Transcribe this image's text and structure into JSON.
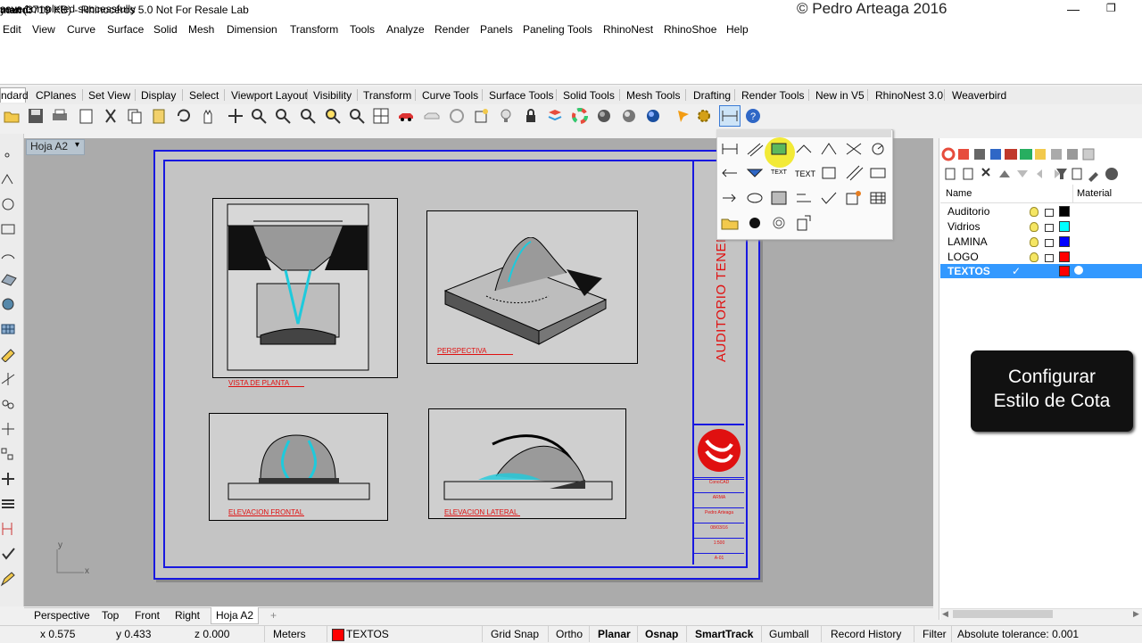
{
  "window": {
    "title": "yout (3719 KB) - Rhinoceros 5.0 Not For Resale Lab",
    "watermark": "© Pedro Arteaga 2016",
    "minimize": "—",
    "maximize": "❐"
  },
  "menu": [
    "Edit",
    "View",
    "Curve",
    "Surface",
    "Solid",
    "Mesh",
    "Dimension",
    "Transform",
    "Tools",
    "Analyze",
    "Render",
    "Panels",
    "Paneling Tools",
    "RhinoNest",
    "RhinoShoe",
    "Help"
  ],
  "command": {
    "history": "save completed successfully",
    "prompt": "mand:"
  },
  "toolbar_tabs": [
    "ndard",
    "CPlanes",
    "Set View",
    "Display",
    "Select",
    "Viewport Layout",
    "Visibility",
    "Transform",
    "Curve Tools",
    "Surface Tools",
    "Solid Tools",
    "Mesh Tools",
    "Drafting",
    "Render Tools",
    "New in V5",
    "RhinoNest 3.0",
    "Weaverbird"
  ],
  "viewport": {
    "name": "Hoja A2",
    "menu_arrow": "▾",
    "axis_y": "y",
    "axis_x": "x"
  },
  "drawing": {
    "project_title": "AUDITORIO TENER",
    "views": [
      "VISTA DE PLANTA",
      "PERSPECTIVA",
      "ELEVACION FRONTAL",
      "ELEVACION LATERAL"
    ],
    "titleblock": [
      "ConoCAD",
      "ARMA",
      "Pedro Arteaga",
      "08/03/16",
      "1:500",
      "A-01"
    ]
  },
  "flyout": {
    "text_labels": [
      "TEXT",
      "TEXT"
    ]
  },
  "layers_panel": {
    "col_name": "Name",
    "col_material": "Material",
    "layers": [
      {
        "name": "Auditorio",
        "color": "#000000",
        "current": false
      },
      {
        "name": "Vidrios",
        "color": "#00ffff",
        "current": false
      },
      {
        "name": "LAMINA",
        "color": "#0000ff",
        "current": false
      },
      {
        "name": "LOGO",
        "color": "#ff0000",
        "current": false
      },
      {
        "name": "TEXTOS",
        "color": "#ff0000",
        "current": true,
        "check": "✓"
      }
    ]
  },
  "tooltip": {
    "line1": "Configurar",
    "line2": "Estilo de Cota"
  },
  "viewport_tabs": [
    "Perspective",
    "Top",
    "Front",
    "Right",
    "Hoja A2"
  ],
  "add_tab": "+",
  "status": {
    "x": "x 0.575",
    "y": "y 0.433",
    "z": "z 0.000",
    "units": "Meters",
    "layer": "TEXTOS",
    "layer_color": "#ff0000",
    "toggles": [
      {
        "label": "Grid Snap",
        "bold": false
      },
      {
        "label": "Ortho",
        "bold": false
      },
      {
        "label": "Planar",
        "bold": true
      },
      {
        "label": "Osnap",
        "bold": true
      },
      {
        "label": "SmartTrack",
        "bold": true
      },
      {
        "label": "Gumball",
        "bold": false
      },
      {
        "label": "Record History",
        "bold": false
      },
      {
        "label": "Filter",
        "bold": false
      }
    ],
    "tolerance": "Absolute tolerance: 0.001"
  },
  "colors": {
    "accent_blue": "#1818e0",
    "drawing_red": "#e01010",
    "selection": "#3399ff"
  }
}
